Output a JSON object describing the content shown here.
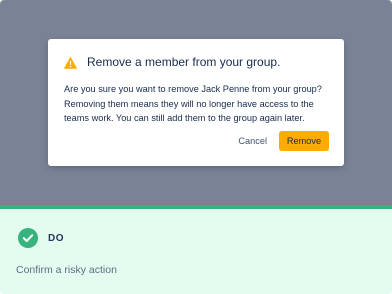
{
  "dialog": {
    "icon": "warning-icon",
    "title": "Remove a member from your group.",
    "body": "Are you sure you want to remove Jack Penne from your group? Removing them means they will no longer have access to the teams work. You can still add them to the group again later.",
    "cancel_label": "Cancel",
    "remove_label": "Remove"
  },
  "guidance": {
    "icon": "check-circle-icon",
    "label": "DO",
    "description": "Confirm a risky action"
  },
  "colors": {
    "overlay": "#7a8395",
    "warning": "#ffab00",
    "success": "#36b37e",
    "success_background": "#e3fcef"
  }
}
